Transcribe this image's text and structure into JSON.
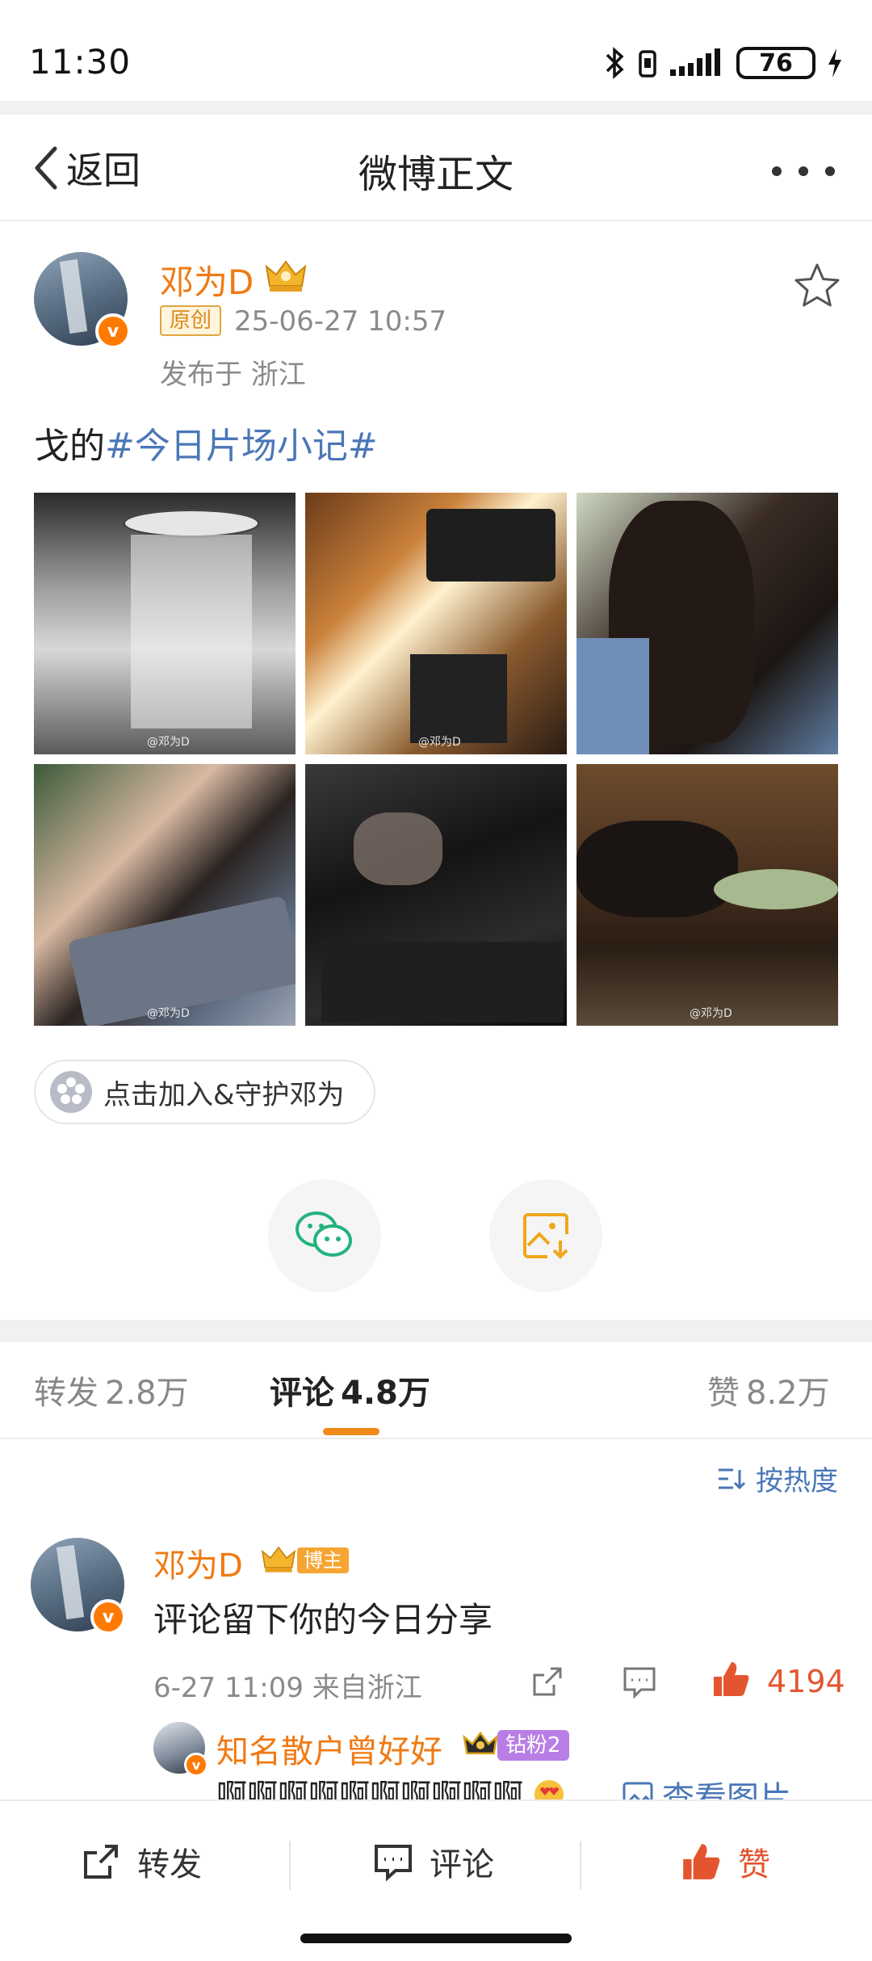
{
  "status_bar": {
    "time": "11:30",
    "battery": "76"
  },
  "navbar": {
    "back_label": "返回",
    "title": "微博正文",
    "more_icon": "more-dots-icon"
  },
  "post": {
    "author": "邓为D",
    "original_badge": "原创",
    "time": "25-06-27 10:57",
    "location": "发布于 浙江",
    "text_prefix": "戈的",
    "hashtag": "#今日片场小记#",
    "image_watermarks": [
      "@邓为D",
      "@邓为D",
      "",
      "@邓为D",
      "",
      "@邓为D"
    ],
    "join_label": "点击加入&守护邓为"
  },
  "share": {
    "wechat_icon": "wechat-icon",
    "save_image_icon": "save-image-icon"
  },
  "tabs": {
    "repost_label": "转发",
    "repost_count": "2.8万",
    "comment_label": "评论",
    "comment_count": "4.8万",
    "like_label": "赞",
    "like_count": "8.2万"
  },
  "sort_label": "按热度",
  "comment": {
    "author": "邓为D",
    "host_badge": "博主",
    "text": "评论留下你的今日分享",
    "meta": "6-27 11:09 来自浙江",
    "like_count": "4194"
  },
  "reply": {
    "author": "知名散户曾好好",
    "fan_badge": "钻粉2",
    "text": "啊啊啊啊啊啊啊啊啊啊",
    "view_image_label": "查看图片"
  },
  "bottom_bar": {
    "repost": "转发",
    "comment": "评论",
    "like": "赞"
  },
  "colors": {
    "accent_orange": "#f07a13",
    "link_blue": "#4a77b7",
    "like_red": "#e3552f"
  }
}
